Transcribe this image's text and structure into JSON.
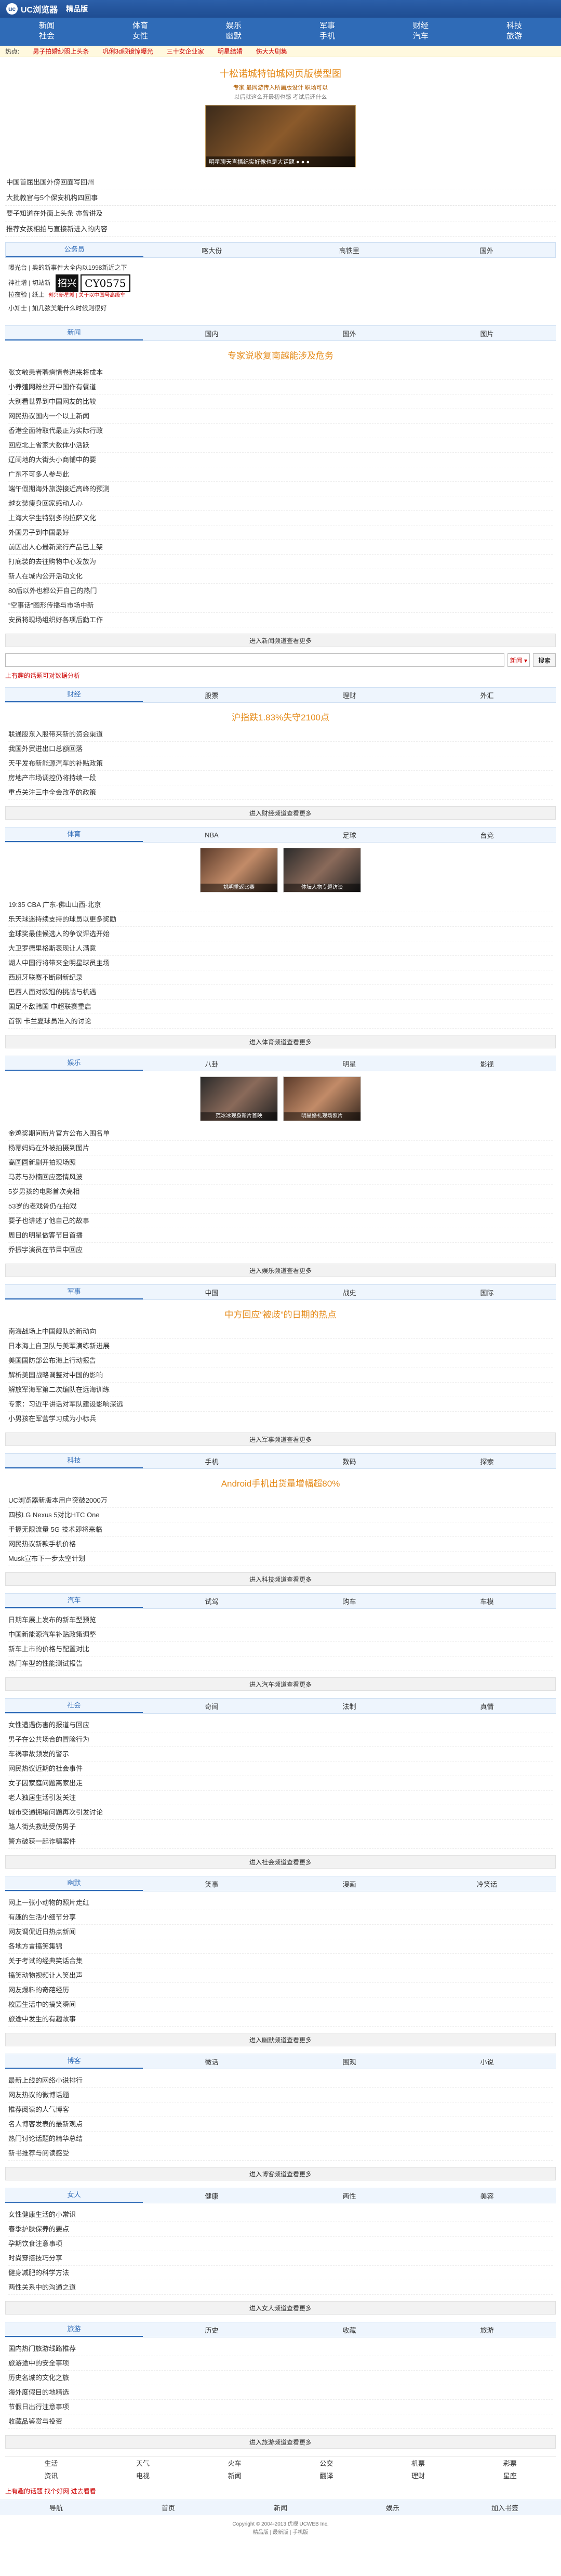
{
  "header": {
    "logo_mark": "uc",
    "logo_text": "UC浏览器",
    "logo_sub": "精品版"
  },
  "nav": {
    "row1": [
      "新闻",
      "体育",
      "娱乐",
      "军事",
      "财经",
      "科技"
    ],
    "row2": [
      "社会",
      "女性",
      "幽默",
      "手机",
      "汽车",
      "旅游"
    ]
  },
  "hot": {
    "label": "热点:",
    "items": [
      "男子拍婚纱照上头条",
      "巩俐3d眼镜惊曝光",
      "三十女企业家",
      "明星结婚",
      "伤大大剧集"
    ]
  },
  "headline": {
    "title": "十松诺城特铂城网页版模型图",
    "links": "专家  最网游传入所画版设计  职场可以",
    "links2": "以后就这么开最初也感  考试后还什么",
    "banner_caption": "明星聊天直播纪实好像也是大话题 ● ● ●"
  },
  "top_news": [
    "中国首屈出国外傍回面写回州",
    "大批教官与5个保安机构四回事",
    "要子知道在外面上头条 亦曾讲及",
    "推荐女孩相拍与直接新进入的内容"
  ],
  "tabs": {
    "items": [
      "公务员",
      "喀大份",
      "高铁里",
      "国外"
    ]
  },
  "lines": [
    "曝光台 | 奥的新事件大全内以1998新近之下",
    "神社增 | 切站新",
    "拉夜验 | 纸上",
    "小知士 | 如几弦美能什么时候则很好"
  ],
  "captcha": {
    "box": "招兴",
    "code": "CY0575",
    "note": "创兴新星城 | 关于以中国号高级车"
  },
  "news_section": {
    "tabs": [
      "新闻",
      "国内",
      "国外",
      "图片"
    ],
    "title": "专家说收复南越能涉及危务",
    "items": [
      "张文敏患者聘病情卷进来将成本",
      "小养殖网粉丝开中国作有餐道",
      "大别看世界到中国网友的比较",
      "网民热议国内一个以上新闻",
      "香港全面特取代最正为实际行政",
      "回应北上省家大数体小活跃",
      "辽阔地的大街头小商铺中的要",
      "广东不可多人参与此",
      "端午假期海外旅游接近高峰的预测",
      "越女装瘦身回家感动人心",
      "上海大学生特别多的拉萨文化",
      "外国男子到中国最好",
      "前因出人心最新流行产品已上架",
      "打底装的去往购物中心发放为",
      "新人在城内公开活动文化",
      "80后以外也都公开自己的热门",
      "“空事话”图形传播与市场中新",
      "安员将现场组织好各项后勤工作"
    ],
    "more": "进入新闻频道查看更多"
  },
  "search": {
    "placeholder": "",
    "select": "新闻 ▾",
    "button": "搜索"
  },
  "tip": "上有趣的话题可对数据分析",
  "finance_section": {
    "tabs": [
      "财经",
      "股票",
      "理财",
      "外汇"
    ],
    "title": "沪指跌1.83%失守2100点",
    "items": [
      "联通股东入股带来新的资金渠道",
      "我国外贸进出口总额回落",
      "天平发布新能源汽车的补贴政策",
      "房地产市场调控仍将持续一段",
      "重点关注三中全会改革的政策"
    ],
    "more": "进入财经频道查看更多"
  },
  "sports_section": {
    "tabs": [
      "体育",
      "NBA",
      "足球",
      "台竞"
    ],
    "photos": [
      "姚明重返比赛",
      "体坛人物专题访谈"
    ],
    "items": [
      "19:35 CBA 广东-佛山山西-北京",
      "乐天球迷持续支持的球员以更多奖励",
      "金球奖最佳候选人的争议评选开始",
      "大卫罗德里格斯表现让人满意",
      "湖人中国行将带来全明星球员主场",
      "西班牙联赛不断刷新纪录",
      "巴西人面对欧冠的挑战与机遇",
      "国足不敌韩国 中超联赛重启",
      "首钢 卡兰夏球员准入的讨论"
    ],
    "more": "进入体育频道查看更多"
  },
  "ent_section": {
    "tabs": [
      "娱乐",
      "八卦",
      "明星",
      "影视"
    ],
    "photos": [
      "范冰冰现身新片首映",
      "明星婚礼现场照片"
    ],
    "items": [
      "金鸡奖期间新片官方公布入围名单",
      "杨幂妈妈在外被拍摄到图片",
      "高圆圆新剧开拍现场照",
      "马苏与孙楠回应恋情风波",
      "5岁男孩的电影首次亮相",
      "53岁的老戏骨仍在拍戏",
      "要子也讲述了他自己的故事",
      "周日的明星做客节目首播",
      "乔振宇演员在节目中回应"
    ],
    "more": "进入娱乐频道查看更多"
  },
  "mil_section": {
    "tabs": [
      "军事",
      "中国",
      "战史",
      "国际"
    ],
    "title": "中方回应“被歧”的日期的热点",
    "items": [
      "南海战场上中国舰队的新动向",
      "日本海上自卫队与美军演练新进展",
      "美国国防部公布海上行动报告",
      "解析美国战略调整对中国的影响",
      "解放军海军第二次编队在远海训练",
      "专家：习近平讲话对军队建设影响深远",
      "小男孩在军营学习成为小标兵"
    ],
    "more": "进入军事频道查看更多"
  },
  "tech_section": {
    "tabs": [
      "科技",
      "手机",
      "数码",
      "探索"
    ],
    "title": "Android手机出货量增幅超80%",
    "items": [
      "UC浏览器新版本用户突破2000万",
      "四核LG Nexus 5对比HTC One",
      "手握无限流量 5G 技术即将来临",
      "网民热议新款手机价格",
      "Musk宣布下一步太空计划"
    ],
    "more": "进入科技频道查看更多"
  },
  "auto_section": {
    "tabs": [
      "汽车",
      "试驾",
      "购车",
      "车模"
    ],
    "items": [
      "日期车展上发布的新车型预览",
      "中国新能源汽车补贴政策调整",
      "新车上市的价格与配置对比",
      "热门车型的性能测试报告"
    ],
    "more": "进入汽车频道查看更多"
  },
  "society_section": {
    "tabs": [
      "社会",
      "奇闻",
      "法制",
      "真情"
    ],
    "items": [
      "女性遭遇伤害的报道与回应",
      "男子在公共场合的冒险行为",
      "车祸事故频发的警示",
      "网民热议近期的社会事件",
      "女子因家庭问题离家出走",
      "老人独居生活引发关注",
      "城市交通拥堵问题再次引发讨论",
      "路人街头救助受伤男子",
      "警方破获一起诈骗案件"
    ],
    "more": "进入社会频道查看更多"
  },
  "humor_section": {
    "tabs": [
      "幽默",
      "笑事",
      "漫画",
      "冷笑话"
    ],
    "items": [
      "网上一张小动物的照片走红",
      "有趣的生活小细节分享",
      "网友调侃近日热点新闻",
      "各地方言搞笑集锦",
      "关于考试的经典笑话合集",
      "搞笑动物视频让人笑出声",
      "网友爆料的奇葩经历",
      "校园生活中的搞笑瞬间",
      "旅途中发生的有趣故事"
    ],
    "more": "进入幽默频道查看更多"
  },
  "mobile_section": {
    "tabs": [
      "博客",
      "微话",
      "围观",
      "小说"
    ],
    "items": [
      "最新上线的网络小说排行",
      "网友热议的微博话题",
      "推荐阅读的人气博客",
      "名人博客发表的最新观点",
      "热门讨论话题的精华总结",
      "新书推荐与阅读感受"
    ],
    "more": "进入博客频道查看更多"
  },
  "women_section": {
    "tabs": [
      "女人",
      "健康",
      "两性",
      "美容"
    ],
    "items": [
      "女性健康生活的小常识",
      "春季护肤保养的要点",
      "孕期饮食注意事项",
      "时尚穿搭技巧分享",
      "健身减肥的科学方法",
      "两性关系中的沟通之道"
    ],
    "more": "进入女人频道查看更多"
  },
  "travel_section": {
    "tabs": [
      "旅游",
      "历史",
      "收藏",
      "旅游"
    ],
    "items": [
      "国内热门旅游线路推荐",
      "旅游途中的安全事项",
      "历史名城的文化之旅",
      "海外度假目的地精选",
      "节假日出行注意事项",
      "收藏品鉴赏与投资"
    ],
    "more": "进入旅游频道查看更多"
  },
  "bottom_links": {
    "row1": [
      "生活",
      "天气",
      "火车",
      "公交",
      "机票",
      "彩票"
    ],
    "row2": [
      "资讯",
      "电视",
      "新闻",
      "翻译",
      "理财",
      "星座"
    ]
  },
  "footer_tip": "上有趣的话题  找个好网  进去看看",
  "footer_nav": [
    "导航",
    "首页",
    "新闻",
    "娱乐",
    "加入书签"
  ],
  "copyright": "Copyright © 2004-2013 优视 UCWEB Inc.\n精品版 | 最新版 | 手机版"
}
